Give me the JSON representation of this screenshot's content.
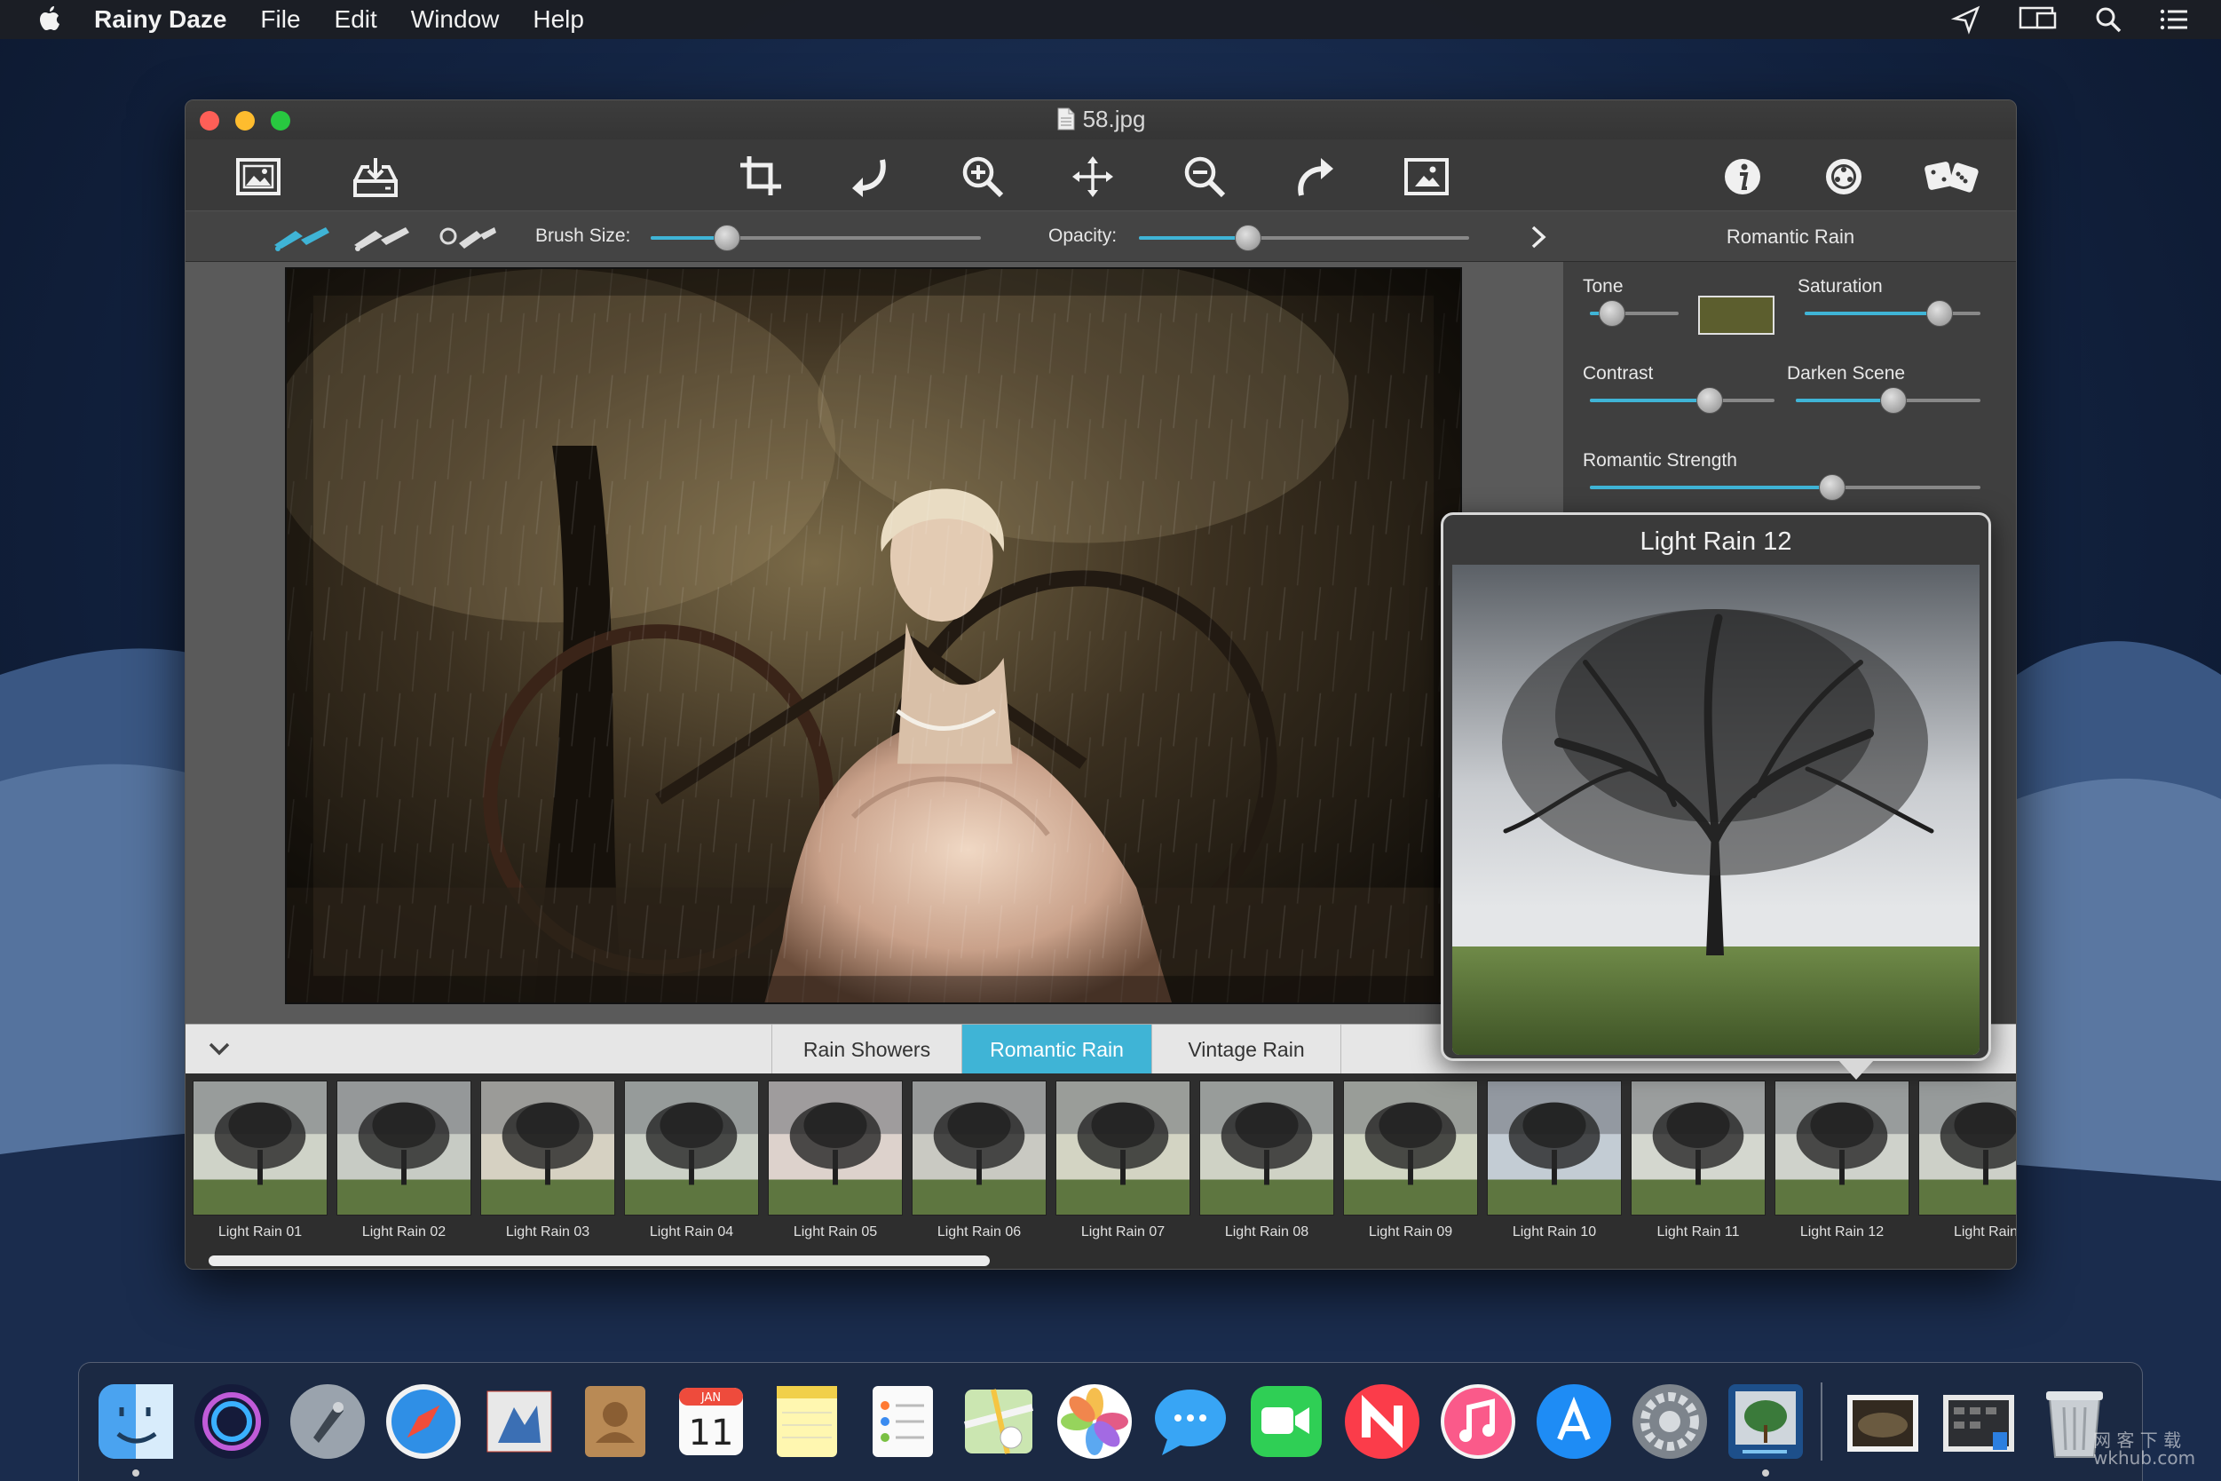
{
  "menubar": {
    "app_name": "Rainy Daze",
    "menus": [
      "File",
      "Edit",
      "Window",
      "Help"
    ]
  },
  "window": {
    "title": "58.jpg"
  },
  "toolbar": {
    "icons": [
      "open-image-icon",
      "save-image-icon",
      "crop-icon",
      "rotate-left-icon",
      "zoom-in-icon",
      "move-icon",
      "zoom-out-icon",
      "rotate-right-icon",
      "fit-image-icon",
      "info-icon",
      "settings-icon",
      "random-dice-icon"
    ]
  },
  "brushbar": {
    "brush_size_label": "Brush Size:",
    "brush_size_value": 0.23,
    "opacity_label": "Opacity:",
    "opacity_value": 0.33,
    "panel_title": "Romantic Rain"
  },
  "adjustments": {
    "tone_label": "Tone",
    "tone_value": 0.25,
    "tone_color": "#5c5e2e",
    "saturation_label": "Saturation",
    "saturation_value": 0.77,
    "contrast_label": "Contrast",
    "contrast_value": 0.65,
    "darken_label": "Darken Scene",
    "darken_value": 0.53,
    "strength_label": "Romantic Strength",
    "strength_value": 0.62
  },
  "preview": {
    "title": "Light Rain 12"
  },
  "tabs": {
    "items": [
      "Rain Showers",
      "Romantic Rain",
      "Vintage Rain"
    ],
    "active": "Romantic Rain"
  },
  "presets": [
    "Light Rain 01",
    "Light Rain 02",
    "Light Rain 03",
    "Light Rain 04",
    "Light Rain 05",
    "Light Rain 06",
    "Light Rain 07",
    "Light Rain 08",
    "Light Rain 09",
    "Light Rain 10",
    "Light Rain 11",
    "Light Rain 12",
    "Light Rain"
  ],
  "dock": {
    "apps": [
      "finder-icon",
      "siri-icon",
      "launchpad-icon",
      "safari-icon",
      "mail-icon",
      "contacts-icon",
      "calendar-icon",
      "notes-icon",
      "reminders-icon",
      "maps-icon",
      "photos-icon",
      "messages-icon",
      "facetime-icon",
      "news-icon",
      "music-icon",
      "app-store-icon",
      "system-preferences-icon",
      "rainy-daze-icon",
      "downloads-stack-icon",
      "documents-stack-icon",
      "trash-icon"
    ],
    "calendar_month": "JAN",
    "calendar_day": "11"
  },
  "watermark": {
    "line1": "网 客 下 载",
    "line2": "wkhub.com"
  },
  "colors": {
    "accent": "#3fb4d6",
    "window_bg": "#3a3a3a",
    "close": "#fe5f57",
    "minimize": "#febc2e",
    "zoom": "#28c840"
  }
}
